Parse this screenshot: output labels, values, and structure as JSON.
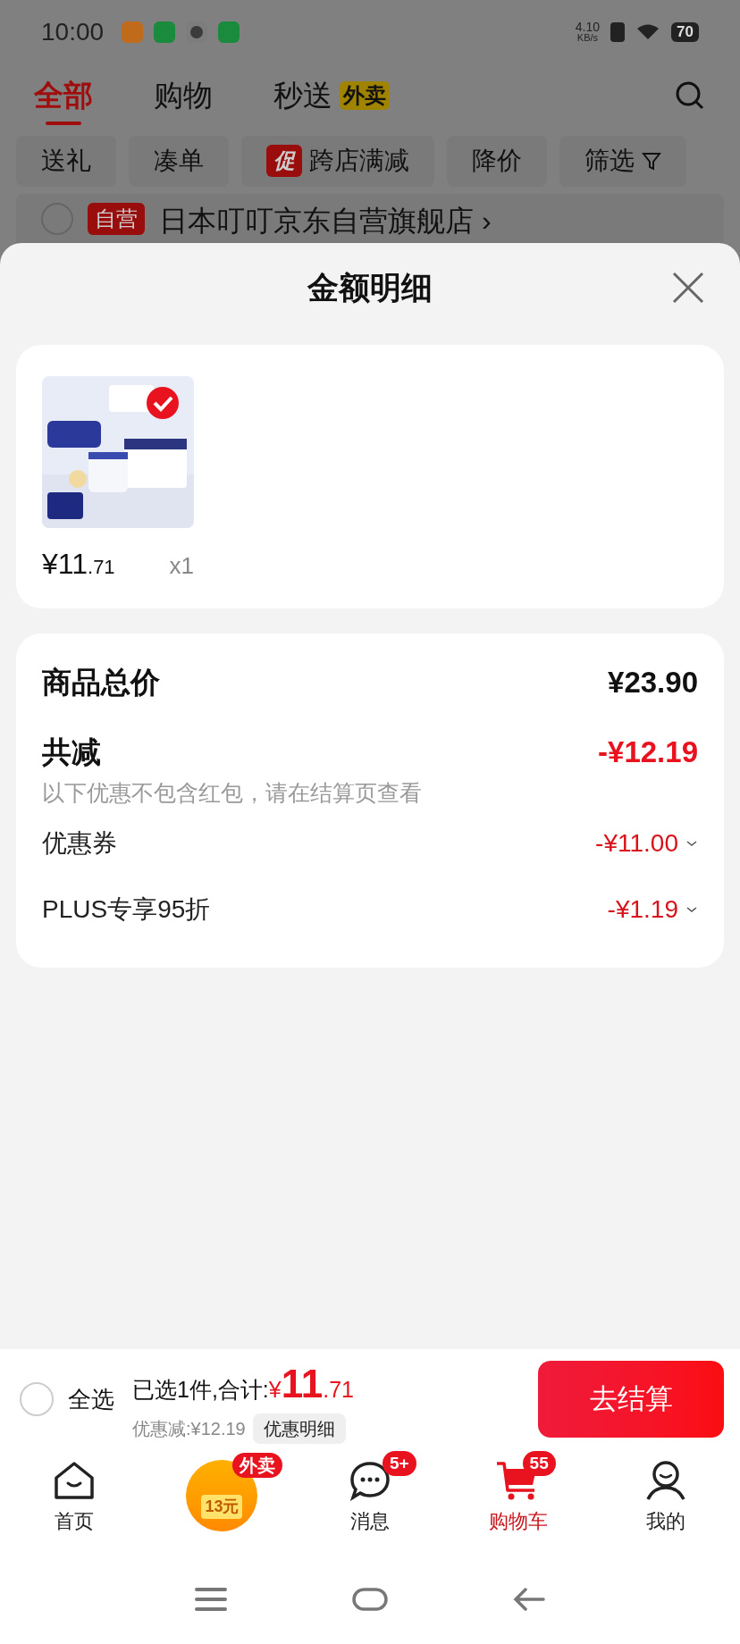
{
  "status_bar": {
    "time": "10:00",
    "net_speed": "4.10",
    "net_unit": "KB/s",
    "battery": "70"
  },
  "top_tabs": [
    {
      "label": "全部",
      "selected": true
    },
    {
      "label": "购物",
      "selected": false
    },
    {
      "label": "秒送",
      "selected": false,
      "badge": "外卖"
    }
  ],
  "filter_chips": [
    {
      "label": "送礼",
      "kind": "plain"
    },
    {
      "label": "凑单",
      "kind": "plain"
    },
    {
      "label": "跨店满减",
      "kind": "promo",
      "tag": "促"
    },
    {
      "label": "降价",
      "kind": "plain"
    },
    {
      "label": "筛选",
      "kind": "filter"
    }
  ],
  "store_row": {
    "checked": false,
    "tag": "自营",
    "name": "日本叮叮京东自营旗舰店 ›"
  },
  "sheet": {
    "title": "金额明细",
    "product": {
      "price_int": "¥11",
      "price_dec": ".71",
      "quantity": "x1"
    },
    "total": {
      "label": "商品总价",
      "value": "¥23.90"
    },
    "reduction": {
      "label": "共减",
      "value": "-¥12.19",
      "note": "以下优惠不包含红包，请在结算页查看"
    },
    "discounts": [
      {
        "label": "优惠券",
        "value": "-¥11.00"
      },
      {
        "label": "PLUS专享95折",
        "value": "-¥1.19"
      }
    ]
  },
  "checkout": {
    "select_all": {
      "label": "全选",
      "checked": false
    },
    "selected_text": "已选1件,合计:",
    "currency": "¥",
    "total_int": "11",
    "total_dec": ".71",
    "discount_text": "优惠减:¥12.19",
    "detail_button": "优惠明细",
    "checkout_button": "去结算"
  },
  "bottom_nav": [
    {
      "kind": "home",
      "label": "首页",
      "selected": false
    },
    {
      "kind": "promo",
      "badge": "外卖",
      "image_text": "13元",
      "selected": false
    },
    {
      "kind": "message",
      "label": "消息",
      "badge": "5+",
      "selected": false
    },
    {
      "kind": "cart",
      "label": "购物车",
      "badge": "55",
      "selected": true
    },
    {
      "kind": "profile",
      "label": "我的",
      "selected": false
    }
  ]
}
